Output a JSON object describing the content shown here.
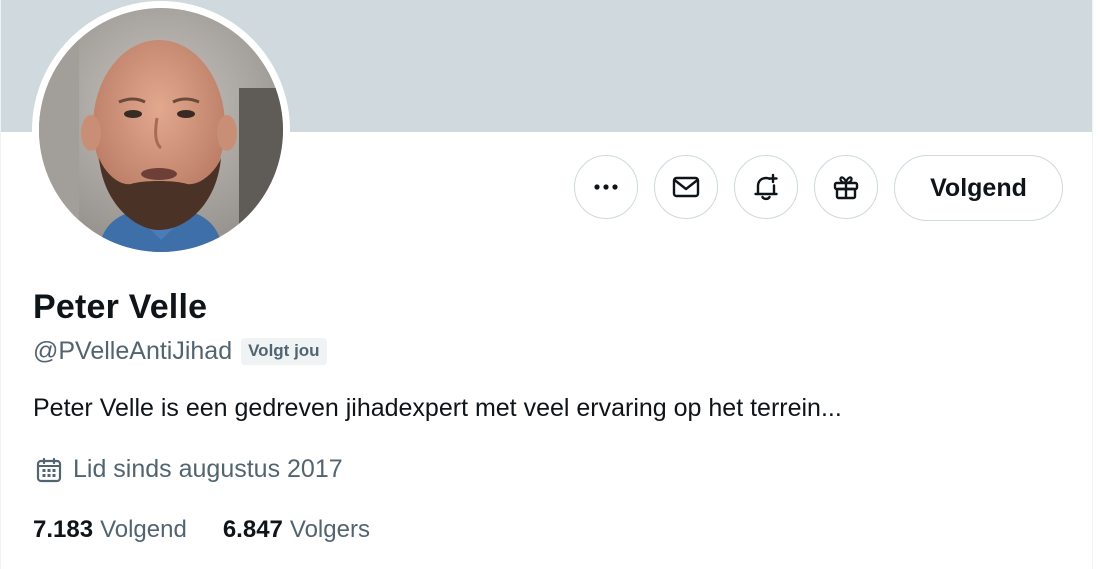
{
  "profile": {
    "display_name": "Peter Velle",
    "handle": "@PVelleAntiJihad",
    "follows_you_badge": "Volgt jou",
    "bio": "Peter Velle is een gedreven jihadexpert met veel ervaring op het terrein...",
    "joined": "Lid sinds augustus 2017"
  },
  "actions": {
    "more_icon": "more-horizontal-icon",
    "message_icon": "envelope-icon",
    "notify_icon": "bell-plus-icon",
    "gift_icon": "gift-icon",
    "follow_label": "Volgend"
  },
  "stats": {
    "following_count": "7.183",
    "following_label": "Volgend",
    "followers_count": "6.847",
    "followers_label": "Volgers"
  },
  "colors": {
    "banner": "#cfd9de",
    "text_primary": "#0f1419",
    "text_secondary": "#536471",
    "border": "#cfd9de",
    "badge_bg": "#eff3f4"
  }
}
